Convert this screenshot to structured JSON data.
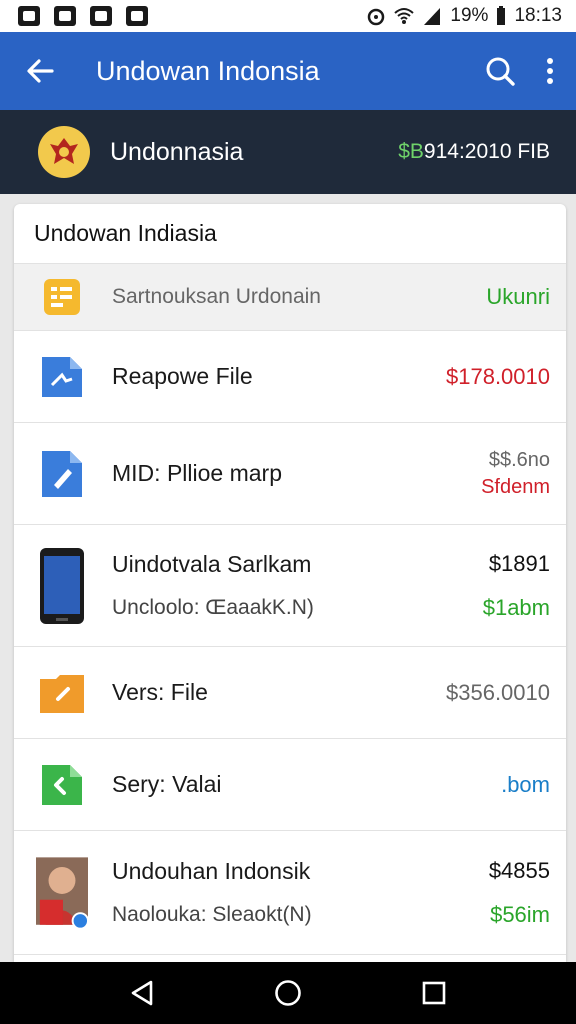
{
  "status_bar": {
    "battery_percent": "19%",
    "time": "18:13"
  },
  "app_bar": {
    "title": "Undowan Indonsia"
  },
  "account": {
    "name": "Undonnasia",
    "balance_prefix": "$B",
    "balance": "914:2010 FIB"
  },
  "card": {
    "title": "Undowan Indiasia"
  },
  "rows": [
    {
      "icon": "yellow-list-icon",
      "title": "Sartnouksan Urdonain",
      "amount": "Ukunri",
      "amount_color": "#2aa52a"
    },
    {
      "icon": "blue-file-icon",
      "title": "Reapowe File",
      "amount": "$178.0010",
      "amount_color": "#d0202a"
    },
    {
      "icon": "blue-edit-file-icon",
      "title": "MID: Pllioe marp",
      "amount": "$$.6no",
      "amount2": "Sfdenm",
      "amount_color": "#666666",
      "amount2_color": "#d0202a"
    },
    {
      "icon": "phone-icon",
      "title": "Uindotvala Sarlkam",
      "subtitle": "Uncloolo: ŒaaakK.N)",
      "amount": "$1891",
      "amount2": "$1abm",
      "amount_color": "#111111",
      "amount2_color": "#2aa52a"
    },
    {
      "icon": "orange-folder-icon",
      "title": "Vers: File",
      "amount": "$356.0010",
      "amount_color": "#666666"
    },
    {
      "icon": "green-file-icon",
      "title": "Sery: Valai",
      "amount": ".bom",
      "amount_color": "#1a7ec8"
    },
    {
      "icon": "avatar-photo",
      "title": "Undouhan Indonsik",
      "subtitle": "Naolouka: Sleaokt(N)",
      "amount": "$4855",
      "amount2": "$56im",
      "amount_color": "#111111",
      "amount2_color": "#2aa52a"
    }
  ],
  "colors": {
    "app_bar": "#2a63c4",
    "account_bar": "#1f2a3a",
    "accent_green": "#2aa52a",
    "accent_red": "#d0202a"
  }
}
